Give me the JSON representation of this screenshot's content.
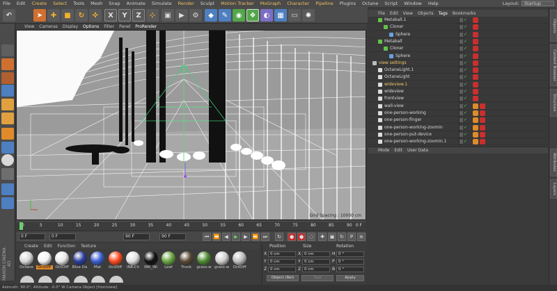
{
  "menubar": {
    "items": [
      "File",
      "Edit",
      "Create",
      "Select",
      "Tools",
      "Mesh",
      "Snap",
      "Animate",
      "Simulate",
      "Render",
      "Sculpt",
      "Motion Tracker",
      "MoGraph",
      "Character",
      "Pipeline",
      "Plugins",
      "Octane",
      "Script",
      "Window",
      "Help"
    ],
    "layout_label": "Layout:",
    "layout_value": "Startup"
  },
  "toolbar": {
    "axis_x": "X",
    "axis_y": "Y",
    "axis_z": "Z"
  },
  "viewport": {
    "menu": [
      "View",
      "Cameras",
      "Display",
      "Options",
      "Filter",
      "Panel",
      "ProRender"
    ],
    "active_menu": "Options",
    "grid_spacing": "Grid Spacing : 10000 cm"
  },
  "timeline": {
    "ticks": [
      "0",
      "5",
      "10",
      "15",
      "20",
      "25",
      "30",
      "35",
      "40",
      "45",
      "50",
      "55",
      "60",
      "65",
      "70",
      "75",
      "80",
      "85",
      "90"
    ],
    "end_frame": "0 F"
  },
  "transport": {
    "start": "0 F",
    "current": "0 F",
    "end": "90 F",
    "end2": "90 F"
  },
  "materials": {
    "menu": [
      "Create",
      "Edit",
      "Function",
      "Texture"
    ],
    "items": [
      {
        "label": "Octane",
        "color": "#d8d8d8",
        "selected": false
      },
      {
        "label": "OctDiff",
        "color": "#f4f4f4",
        "selected": true
      },
      {
        "label": "OctDiff",
        "color": "#e8e8e8",
        "selected": false
      },
      {
        "label": "Blue Da",
        "color": "#2a3e9a",
        "selected": false
      },
      {
        "label": "Mat",
        "color": "#3c5fd0",
        "selected": false
      },
      {
        "label": "OctDiff",
        "color": "#ff4a20",
        "selected": false
      },
      {
        "label": "INK-Ch",
        "color": "#e0e0e0",
        "selected": false
      },
      {
        "label": "INK_Wi",
        "color": "#111111",
        "selected": false
      },
      {
        "label": "Leaf",
        "color": "#68a540",
        "selected": false
      },
      {
        "label": "Trunk",
        "color": "#5a4a36",
        "selected": false
      },
      {
        "label": "grass-w",
        "color": "#4f8a33",
        "selected": false
      },
      {
        "label": "grass-w",
        "color": "#cfcfcf",
        "selected": false
      },
      {
        "label": "OctDiff",
        "color": "#bdbdbd",
        "selected": false
      }
    ]
  },
  "coordinates": {
    "headers": [
      "Position",
      "Size",
      "Rotation"
    ],
    "rows": [
      {
        "axis": "X",
        "pos": "0 cm",
        "size": "0 cm",
        "rot_label": "H",
        "rot": "0 °"
      },
      {
        "axis": "Y",
        "pos": "0 cm",
        "size": "0 cm",
        "rot_label": "P",
        "rot": "0 °"
      },
      {
        "axis": "Z",
        "pos": "0 cm",
        "size": "0 cm",
        "rot_label": "B",
        "rot": "0 °"
      }
    ],
    "mode": "Object (Rel)",
    "size_mode": "Size",
    "apply": "Apply"
  },
  "objects": {
    "menu": [
      "File",
      "Edit",
      "View",
      "Objects",
      "Tags",
      "Bookmarks"
    ],
    "active_menu": "Tags",
    "rows": [
      {
        "name": "Metaball.1",
        "indent": 1,
        "highlight": false,
        "icon": "#62c24a"
      },
      {
        "name": "Cloner",
        "indent": 2,
        "highlight": false,
        "icon": "#62c24a"
      },
      {
        "name": "Sphere",
        "indent": 3,
        "highlight": false,
        "icon": "#6aa0e0"
      },
      {
        "name": "Metaball",
        "indent": 1,
        "highlight": false,
        "icon": "#62c24a"
      },
      {
        "name": "Cloner",
        "indent": 2,
        "highlight": false,
        "icon": "#62c24a"
      },
      {
        "name": "Sphere",
        "indent": 3,
        "highlight": false,
        "icon": "#6aa0e0"
      },
      {
        "name": "view settings",
        "indent": 0,
        "highlight": true,
        "icon": "#bbbbbb"
      },
      {
        "name": "OctaneLight.1",
        "indent": 1,
        "highlight": false,
        "icon": "#dddddd"
      },
      {
        "name": "OctaneLight",
        "indent": 1,
        "highlight": false,
        "icon": "#dddddd"
      },
      {
        "name": "wideview.1",
        "indent": 1,
        "highlight": true,
        "icon": "#dddddd"
      },
      {
        "name": "wideview",
        "indent": 1,
        "highlight": false,
        "icon": "#dddddd"
      },
      {
        "name": "frontview",
        "indent": 1,
        "highlight": false,
        "icon": "#dddddd"
      },
      {
        "name": "wall-view",
        "indent": 1,
        "highlight": false,
        "icon": "#dddddd"
      },
      {
        "name": "one-person-working",
        "indent": 1,
        "highlight": false,
        "icon": "#dddddd"
      },
      {
        "name": "one-person-finger",
        "indent": 1,
        "highlight": false,
        "icon": "#dddddd"
      },
      {
        "name": "one-person-working-zoomin",
        "indent": 1,
        "highlight": false,
        "icon": "#dddddd"
      },
      {
        "name": "one-person-put-device",
        "indent": 1,
        "highlight": false,
        "icon": "#dddddd"
      },
      {
        "name": "one-person-working-zoomin.1",
        "indent": 1,
        "highlight": false,
        "icon": "#dddddd"
      }
    ]
  },
  "attributes": {
    "menu": [
      "Mode",
      "Edit",
      "User Data"
    ]
  },
  "right_tabs": [
    "Objects",
    "Content Browser",
    "Structure",
    "Attributes",
    "Layers"
  ],
  "status": {
    "text": "Azimuth: 90.0°, Altitude: -0.0° W    Camera Object [frontview]"
  },
  "maxon": "MAXON CINEMA 4D"
}
